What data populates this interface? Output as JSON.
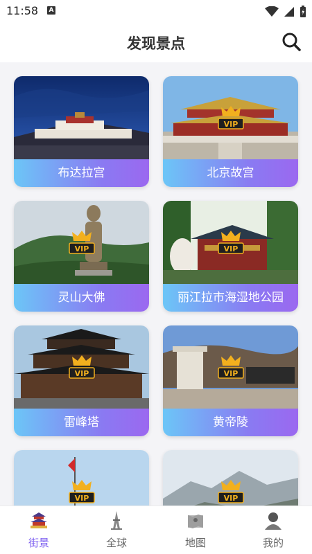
{
  "status_bar": {
    "time": "11:58",
    "notification_icon": "A"
  },
  "header": {
    "title": "发现景点",
    "search_icon": "search-icon"
  },
  "spots": [
    {
      "name": "布达拉宫",
      "vip": false
    },
    {
      "name": "北京故宫",
      "vip": true
    },
    {
      "name": "灵山大佛",
      "vip": true
    },
    {
      "name": "丽江拉市海湿地公园",
      "vip": true
    },
    {
      "name": "雷峰塔",
      "vip": true
    },
    {
      "name": "黄帝陵",
      "vip": true
    },
    {
      "name": "",
      "vip": true
    },
    {
      "name": "",
      "vip": true
    }
  ],
  "vip_label": "VIP",
  "tabs": [
    {
      "label": "街景",
      "icon": "temple-icon",
      "active": true
    },
    {
      "label": "全球",
      "icon": "tower-icon",
      "active": false
    },
    {
      "label": "地图",
      "icon": "map-icon",
      "active": false
    },
    {
      "label": "我的",
      "icon": "user-icon",
      "active": false
    }
  ],
  "colors": {
    "accent": "#7b5cf0",
    "label_gradient_start": "#6cc6f7",
    "label_gradient_end": "#9b68f0"
  }
}
